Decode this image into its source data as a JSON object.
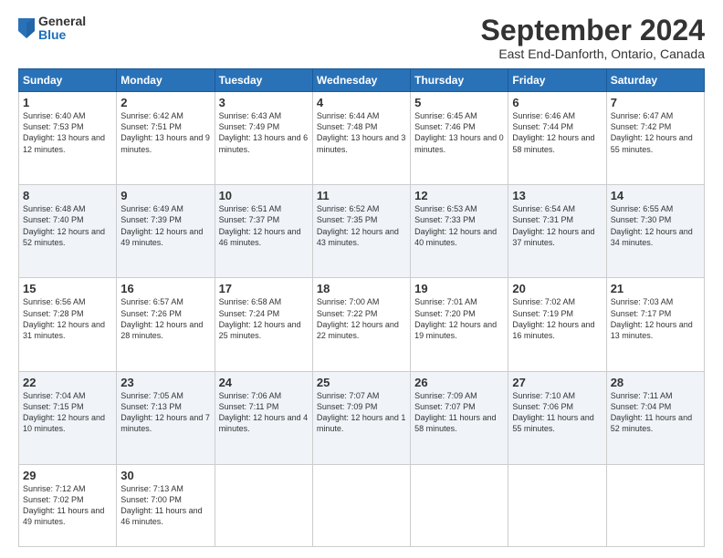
{
  "logo": {
    "general": "General",
    "blue": "Blue"
  },
  "title": "September 2024",
  "location": "East End-Danforth, Ontario, Canada",
  "headers": [
    "Sunday",
    "Monday",
    "Tuesday",
    "Wednesday",
    "Thursday",
    "Friday",
    "Saturday"
  ],
  "weeks": [
    [
      {
        "day": "1",
        "sunrise": "6:40 AM",
        "sunset": "7:53 PM",
        "daylight": "13 hours and 12 minutes."
      },
      {
        "day": "2",
        "sunrise": "6:42 AM",
        "sunset": "7:51 PM",
        "daylight": "13 hours and 9 minutes."
      },
      {
        "day": "3",
        "sunrise": "6:43 AM",
        "sunset": "7:49 PM",
        "daylight": "13 hours and 6 minutes."
      },
      {
        "day": "4",
        "sunrise": "6:44 AM",
        "sunset": "7:48 PM",
        "daylight": "13 hours and 3 minutes."
      },
      {
        "day": "5",
        "sunrise": "6:45 AM",
        "sunset": "7:46 PM",
        "daylight": "13 hours and 0 minutes."
      },
      {
        "day": "6",
        "sunrise": "6:46 AM",
        "sunset": "7:44 PM",
        "daylight": "12 hours and 58 minutes."
      },
      {
        "day": "7",
        "sunrise": "6:47 AM",
        "sunset": "7:42 PM",
        "daylight": "12 hours and 55 minutes."
      }
    ],
    [
      {
        "day": "8",
        "sunrise": "6:48 AM",
        "sunset": "7:40 PM",
        "daylight": "12 hours and 52 minutes."
      },
      {
        "day": "9",
        "sunrise": "6:49 AM",
        "sunset": "7:39 PM",
        "daylight": "12 hours and 49 minutes."
      },
      {
        "day": "10",
        "sunrise": "6:51 AM",
        "sunset": "7:37 PM",
        "daylight": "12 hours and 46 minutes."
      },
      {
        "day": "11",
        "sunrise": "6:52 AM",
        "sunset": "7:35 PM",
        "daylight": "12 hours and 43 minutes."
      },
      {
        "day": "12",
        "sunrise": "6:53 AM",
        "sunset": "7:33 PM",
        "daylight": "12 hours and 40 minutes."
      },
      {
        "day": "13",
        "sunrise": "6:54 AM",
        "sunset": "7:31 PM",
        "daylight": "12 hours and 37 minutes."
      },
      {
        "day": "14",
        "sunrise": "6:55 AM",
        "sunset": "7:30 PM",
        "daylight": "12 hours and 34 minutes."
      }
    ],
    [
      {
        "day": "15",
        "sunrise": "6:56 AM",
        "sunset": "7:28 PM",
        "daylight": "12 hours and 31 minutes."
      },
      {
        "day": "16",
        "sunrise": "6:57 AM",
        "sunset": "7:26 PM",
        "daylight": "12 hours and 28 minutes."
      },
      {
        "day": "17",
        "sunrise": "6:58 AM",
        "sunset": "7:24 PM",
        "daylight": "12 hours and 25 minutes."
      },
      {
        "day": "18",
        "sunrise": "7:00 AM",
        "sunset": "7:22 PM",
        "daylight": "12 hours and 22 minutes."
      },
      {
        "day": "19",
        "sunrise": "7:01 AM",
        "sunset": "7:20 PM",
        "daylight": "12 hours and 19 minutes."
      },
      {
        "day": "20",
        "sunrise": "7:02 AM",
        "sunset": "7:19 PM",
        "daylight": "12 hours and 16 minutes."
      },
      {
        "day": "21",
        "sunrise": "7:03 AM",
        "sunset": "7:17 PM",
        "daylight": "12 hours and 13 minutes."
      }
    ],
    [
      {
        "day": "22",
        "sunrise": "7:04 AM",
        "sunset": "7:15 PM",
        "daylight": "12 hours and 10 minutes."
      },
      {
        "day": "23",
        "sunrise": "7:05 AM",
        "sunset": "7:13 PM",
        "daylight": "12 hours and 7 minutes."
      },
      {
        "day": "24",
        "sunrise": "7:06 AM",
        "sunset": "7:11 PM",
        "daylight": "12 hours and 4 minutes."
      },
      {
        "day": "25",
        "sunrise": "7:07 AM",
        "sunset": "7:09 PM",
        "daylight": "12 hours and 1 minute."
      },
      {
        "day": "26",
        "sunrise": "7:09 AM",
        "sunset": "7:07 PM",
        "daylight": "11 hours and 58 minutes."
      },
      {
        "day": "27",
        "sunrise": "7:10 AM",
        "sunset": "7:06 PM",
        "daylight": "11 hours and 55 minutes."
      },
      {
        "day": "28",
        "sunrise": "7:11 AM",
        "sunset": "7:04 PM",
        "daylight": "11 hours and 52 minutes."
      }
    ],
    [
      {
        "day": "29",
        "sunrise": "7:12 AM",
        "sunset": "7:02 PM",
        "daylight": "11 hours and 49 minutes."
      },
      {
        "day": "30",
        "sunrise": "7:13 AM",
        "sunset": "7:00 PM",
        "daylight": "11 hours and 46 minutes."
      },
      null,
      null,
      null,
      null,
      null
    ]
  ],
  "labels": {
    "sunrise": "Sunrise:",
    "sunset": "Sunset:",
    "daylight": "Daylight:"
  }
}
